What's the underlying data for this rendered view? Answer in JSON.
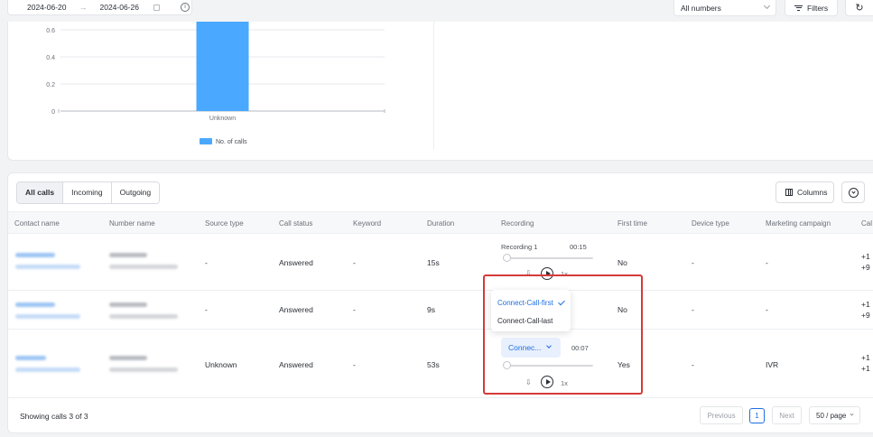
{
  "filters": {
    "start_date": "2024-06-20",
    "arrow": "→",
    "end_date": "2024-06-26",
    "info_glyph": "i",
    "numbers_select": "All numbers",
    "filters_label": "Filters",
    "refresh_glyph": "↻"
  },
  "chart_data": {
    "type": "bar",
    "categories": [
      "Unknown"
    ],
    "series": [
      {
        "name": "No. of calls",
        "values": [
          0.66
        ]
      }
    ],
    "y_ticks": [
      "0",
      "0.2",
      "0.4",
      "0.6"
    ],
    "ylim": [
      0,
      0.66
    ],
    "grid": true,
    "legend_position": "bottom-center",
    "color": "#4aa8ff",
    "title": "",
    "xlabel": "",
    "ylabel": ""
  },
  "tabs": [
    {
      "label": "All calls",
      "active": true
    },
    {
      "label": "Incoming",
      "active": false
    },
    {
      "label": "Outgoing",
      "active": false
    }
  ],
  "toolbar": {
    "columns_label": "Columns"
  },
  "columns": [
    "Contact name",
    "Number name",
    "Source type",
    "Call status",
    "Keyword",
    "Duration",
    "Recording",
    "First time",
    "Device type",
    "Marketing campaign",
    "Cal"
  ],
  "rows": [
    {
      "source_type": "-",
      "call_status": "Answered",
      "keyword": "-",
      "duration": "15s",
      "recording_label": "Recording 1",
      "recording_time": "00:15",
      "speed": "1x",
      "first_time": "No",
      "device_type": "-",
      "marketing_campaign": "-",
      "cal_1": "+1",
      "cal_2": "+9"
    },
    {
      "source_type": "-",
      "call_status": "Answered",
      "keyword": "-",
      "duration": "9s",
      "first_time": "No",
      "device_type": "-",
      "marketing_campaign": "-",
      "cal_1": "+1",
      "cal_2": "+9"
    },
    {
      "source_type": "Unknown",
      "call_status": "Answered",
      "keyword": "-",
      "duration": "53s",
      "recording_select": "Connec...",
      "recording_time": "00:07",
      "speed": "1x",
      "first_time": "Yes",
      "device_type": "-",
      "marketing_campaign": "IVR",
      "cal_1": "+1",
      "cal_2": "+1"
    }
  ],
  "recording_dropdown": {
    "options": [
      {
        "label": "Connect-Call-first",
        "selected": true
      },
      {
        "label": "Connect-Call-last",
        "selected": false
      }
    ]
  },
  "footer": {
    "showing_text": "Showing calls 3 of 3",
    "previous_label": "Previous",
    "current_page": "1",
    "next_label": "Next",
    "page_size": "50 / page"
  },
  "colors": {
    "accent": "#1f6fe0",
    "bar": "#4aa8ff",
    "highlight": "#d63a3a"
  }
}
